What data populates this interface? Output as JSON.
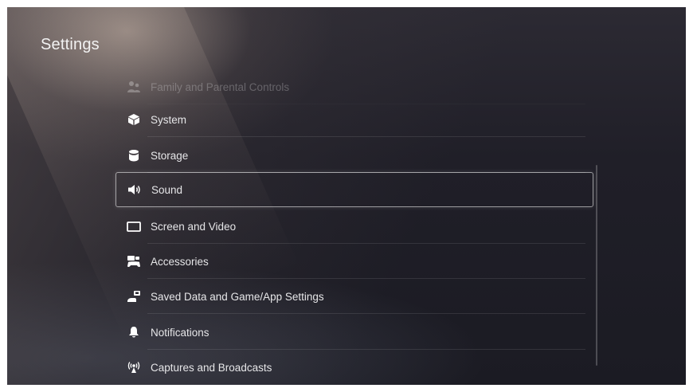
{
  "header": {
    "title": "Settings"
  },
  "menu": {
    "items": [
      {
        "label": "Family and Parental Controls",
        "icon": "family-icon"
      },
      {
        "label": "System",
        "icon": "system-cube-icon"
      },
      {
        "label": "Storage",
        "icon": "storage-icon"
      },
      {
        "label": "Sound",
        "icon": "speaker-icon"
      },
      {
        "label": "Screen and Video",
        "icon": "screen-icon"
      },
      {
        "label": "Accessories",
        "icon": "accessories-icon"
      },
      {
        "label": "Saved Data and Game/App Settings",
        "icon": "saved-data-icon"
      },
      {
        "label": "Notifications",
        "icon": "bell-icon"
      },
      {
        "label": "Captures and Broadcasts",
        "icon": "broadcast-icon"
      }
    ],
    "selected": "Sound"
  }
}
